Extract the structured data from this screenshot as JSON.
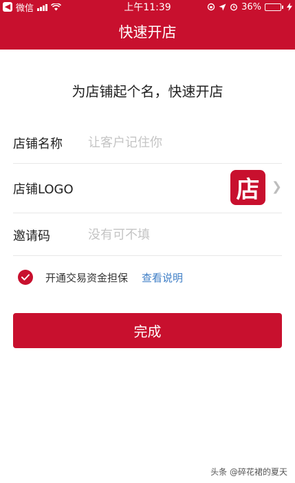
{
  "status_bar": {
    "carrier": "微信",
    "time": "上午11:39",
    "battery": "36%",
    "battery_level": 0.36,
    "back_icon": "back-arrow-icon"
  },
  "nav": {
    "title": "快速开店"
  },
  "heading": "为店铺起个名，快速开店",
  "form": {
    "shop_name": {
      "label": "店铺名称",
      "placeholder": "让客户记住你",
      "value": ""
    },
    "shop_logo": {
      "label": "店铺LOGO",
      "logo_char": "店"
    },
    "invite_code": {
      "label": "邀请码",
      "placeholder": "没有可不填",
      "value": ""
    }
  },
  "guarantee": {
    "label": "开通交易资金担保",
    "link": "查看说明",
    "checked": true
  },
  "submit_label": "完成",
  "watermark": "头条 @碎花裙的夏天",
  "colors": {
    "brand": "#c8102e",
    "link": "#3e7ec6",
    "placeholder": "#c4c4c4"
  }
}
